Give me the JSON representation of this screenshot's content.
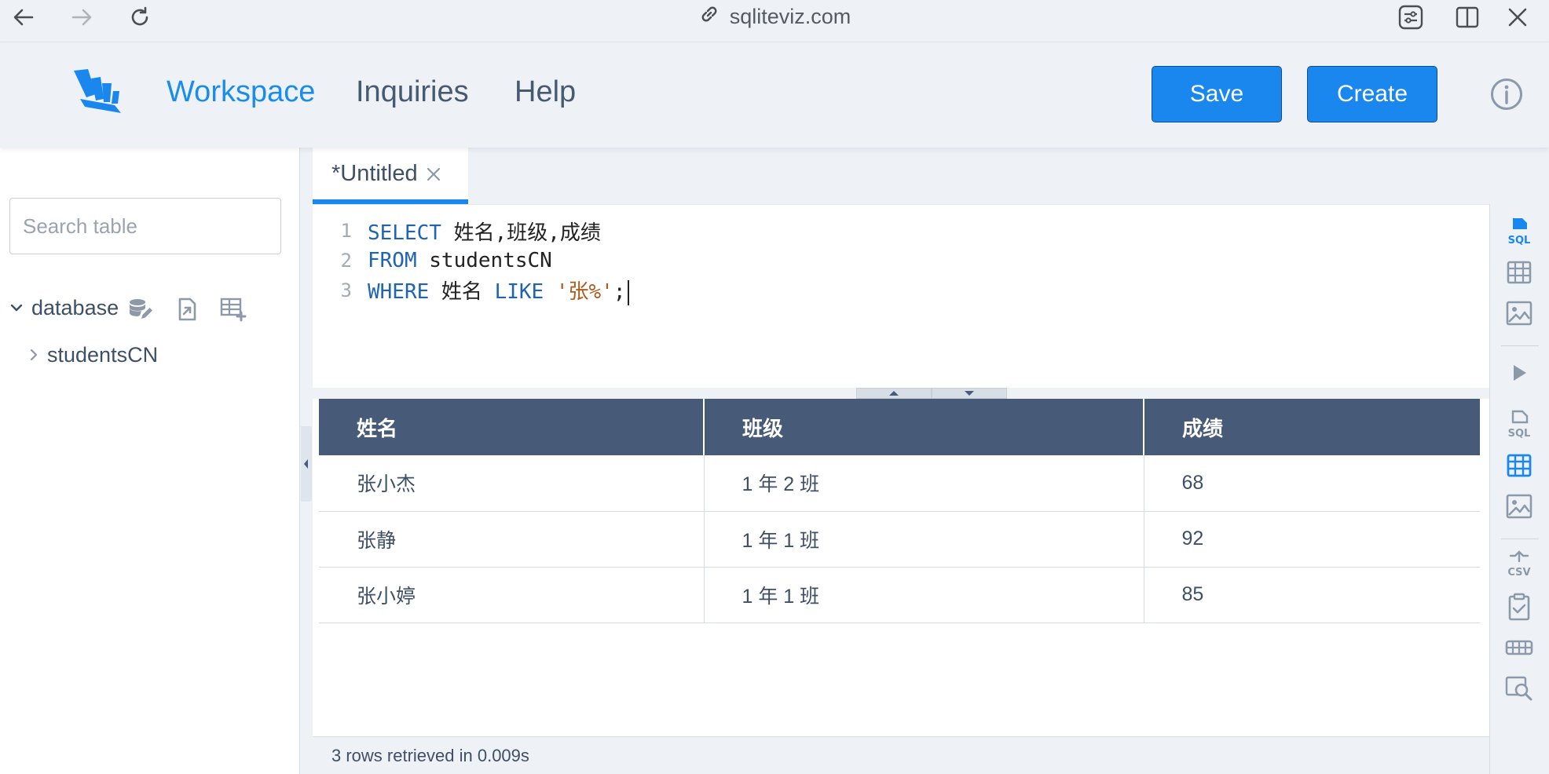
{
  "browser": {
    "url": "sqliteviz.com"
  },
  "header": {
    "nav": {
      "workspace": "Workspace",
      "inquiries": "Inquiries",
      "help": "Help"
    },
    "save_label": "Save",
    "create_label": "Create"
  },
  "sidebar": {
    "search_placeholder": "Search table",
    "database_label": "database",
    "tables": [
      "studentsCN"
    ]
  },
  "tab": {
    "title": "*Untitled"
  },
  "editor": {
    "lines": [
      {
        "num": "1",
        "kw1": "SELECT",
        "rest1": " 姓名,班级,成绩"
      },
      {
        "num": "2",
        "kw1": "FROM",
        "rest1": " studentsCN"
      },
      {
        "num": "3",
        "kw1": "WHERE",
        "rest1": " 姓名 ",
        "kw2": "LIKE",
        "str": " '张%'",
        "tail": ";"
      }
    ]
  },
  "results": {
    "columns": [
      "姓名",
      "班级",
      "成绩"
    ],
    "rows": [
      [
        "张小杰",
        "1 年 2 班",
        "68"
      ],
      [
        "张静",
        "1 年 1 班",
        "92"
      ],
      [
        "张小婷",
        "1 年 1 班",
        "85"
      ]
    ]
  },
  "status": {
    "text": "3 rows retrieved in 0.009s"
  },
  "colors": {
    "accent": "#1a87ee",
    "table_header": "#475b78",
    "keyword": "#1f63b5",
    "string": "#b05a1b"
  }
}
